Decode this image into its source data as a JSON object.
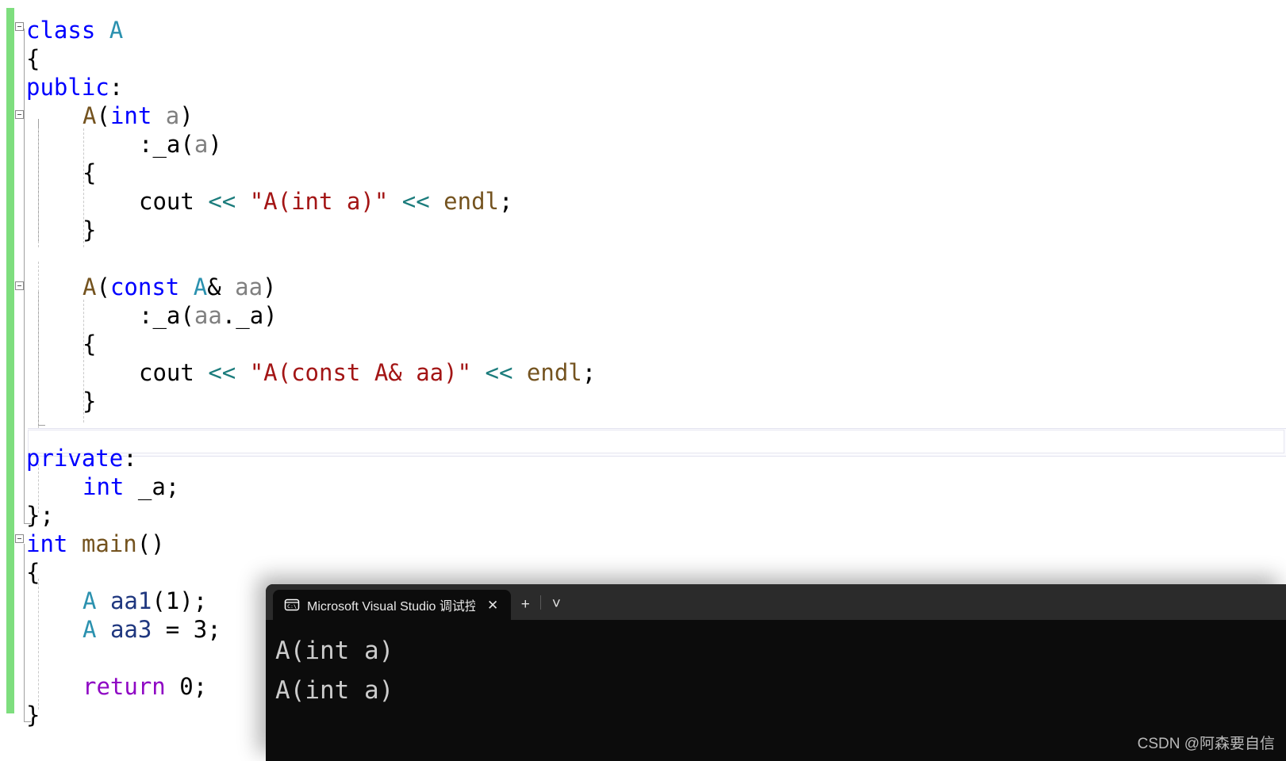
{
  "editor": {
    "name": "visual-studio-code-editor",
    "background": "#ffffff",
    "change_bar_color": "#7ede7e",
    "code_lines": [
      {
        "indent": 0,
        "tokens": [
          {
            "t": "class",
            "c": "kw"
          },
          {
            "t": " ",
            "c": "plain"
          },
          {
            "t": "A",
            "c": "type"
          }
        ]
      },
      {
        "indent": 0,
        "tokens": [
          {
            "t": "{",
            "c": "plain"
          }
        ]
      },
      {
        "indent": 0,
        "tokens": [
          {
            "t": "public",
            "c": "kw"
          },
          {
            "t": ":",
            "c": "plain"
          }
        ]
      },
      {
        "indent": 1,
        "tokens": [
          {
            "t": "A",
            "c": "fn"
          },
          {
            "t": "(",
            "c": "plain"
          },
          {
            "t": "int",
            "c": "kw"
          },
          {
            "t": " ",
            "c": "plain"
          },
          {
            "t": "a",
            "c": "param"
          },
          {
            "t": ")",
            "c": "plain"
          }
        ]
      },
      {
        "indent": 2,
        "tokens": [
          {
            "t": ":",
            "c": "plain"
          },
          {
            "t": "_a",
            "c": "member"
          },
          {
            "t": "(",
            "c": "plain"
          },
          {
            "t": "a",
            "c": "param"
          },
          {
            "t": ")",
            "c": "plain"
          }
        ]
      },
      {
        "indent": 1,
        "tokens": [
          {
            "t": "{",
            "c": "plain"
          }
        ]
      },
      {
        "indent": 2,
        "tokens": [
          {
            "t": "cout",
            "c": "plain"
          },
          {
            "t": " ",
            "c": "plain"
          },
          {
            "t": "<<",
            "c": "op"
          },
          {
            "t": " ",
            "c": "plain"
          },
          {
            "t": "\"A(int a)\"",
            "c": "str"
          },
          {
            "t": " ",
            "c": "plain"
          },
          {
            "t": "<<",
            "c": "op"
          },
          {
            "t": " ",
            "c": "plain"
          },
          {
            "t": "endl",
            "c": "fn"
          },
          {
            "t": ";",
            "c": "plain"
          }
        ]
      },
      {
        "indent": 1,
        "tokens": [
          {
            "t": "}",
            "c": "plain"
          }
        ]
      },
      {
        "indent": 0,
        "tokens": []
      },
      {
        "indent": 1,
        "tokens": [
          {
            "t": "A",
            "c": "fn"
          },
          {
            "t": "(",
            "c": "plain"
          },
          {
            "t": "const",
            "c": "kw"
          },
          {
            "t": " ",
            "c": "plain"
          },
          {
            "t": "A",
            "c": "type"
          },
          {
            "t": "&",
            "c": "plain"
          },
          {
            "t": " ",
            "c": "plain"
          },
          {
            "t": "aa",
            "c": "param"
          },
          {
            "t": ")",
            "c": "plain"
          }
        ]
      },
      {
        "indent": 2,
        "tokens": [
          {
            "t": ":",
            "c": "plain"
          },
          {
            "t": "_a",
            "c": "member"
          },
          {
            "t": "(",
            "c": "plain"
          },
          {
            "t": "aa",
            "c": "param"
          },
          {
            "t": ".",
            "c": "plain"
          },
          {
            "t": "_a",
            "c": "member"
          },
          {
            "t": ")",
            "c": "plain"
          }
        ]
      },
      {
        "indent": 1,
        "tokens": [
          {
            "t": "{",
            "c": "plain"
          }
        ]
      },
      {
        "indent": 2,
        "tokens": [
          {
            "t": "cout",
            "c": "plain"
          },
          {
            "t": " ",
            "c": "plain"
          },
          {
            "t": "<<",
            "c": "op"
          },
          {
            "t": " ",
            "c": "plain"
          },
          {
            "t": "\"A(const A& aa)\"",
            "c": "str"
          },
          {
            "t": " ",
            "c": "plain"
          },
          {
            "t": "<<",
            "c": "op"
          },
          {
            "t": " ",
            "c": "plain"
          },
          {
            "t": "endl",
            "c": "fn"
          },
          {
            "t": ";",
            "c": "plain"
          }
        ]
      },
      {
        "indent": 1,
        "tokens": [
          {
            "t": "}",
            "c": "plain"
          }
        ]
      },
      {
        "indent": 0,
        "tokens": []
      },
      {
        "indent": 0,
        "tokens": [
          {
            "t": "private",
            "c": "kw"
          },
          {
            "t": ":",
            "c": "plain"
          }
        ]
      },
      {
        "indent": 1,
        "tokens": [
          {
            "t": "int",
            "c": "kw"
          },
          {
            "t": " ",
            "c": "plain"
          },
          {
            "t": "_a",
            "c": "member"
          },
          {
            "t": ";",
            "c": "plain"
          }
        ]
      },
      {
        "indent": 0,
        "tokens": [
          {
            "t": "};",
            "c": "plain"
          }
        ]
      },
      {
        "indent": 0,
        "tokens": [
          {
            "t": "int",
            "c": "kw"
          },
          {
            "t": " ",
            "c": "plain"
          },
          {
            "t": "main",
            "c": "fn"
          },
          {
            "t": "()",
            "c": "plain"
          }
        ]
      },
      {
        "indent": 0,
        "tokens": [
          {
            "t": "{",
            "c": "plain"
          }
        ]
      },
      {
        "indent": 1,
        "tokens": [
          {
            "t": "A",
            "c": "type"
          },
          {
            "t": " ",
            "c": "plain"
          },
          {
            "t": "aa1",
            "c": "local"
          },
          {
            "t": "(",
            "c": "plain"
          },
          {
            "t": "1",
            "c": "plain"
          },
          {
            "t": ");",
            "c": "plain"
          }
        ]
      },
      {
        "indent": 1,
        "tokens": [
          {
            "t": "A",
            "c": "type"
          },
          {
            "t": " ",
            "c": "plain"
          },
          {
            "t": "aa3",
            "c": "local"
          },
          {
            "t": " = ",
            "c": "plain"
          },
          {
            "t": "3",
            "c": "plain"
          },
          {
            "t": ";",
            "c": "plain"
          }
        ]
      },
      {
        "indent": 0,
        "tokens": []
      },
      {
        "indent": 1,
        "tokens": [
          {
            "t": "return",
            "c": "ctrl"
          },
          {
            "t": " ",
            "c": "plain"
          },
          {
            "t": "0",
            "c": "plain"
          },
          {
            "t": ";",
            "c": "plain"
          }
        ]
      },
      {
        "indent": 0,
        "tokens": [
          {
            "t": "}",
            "c": "plain"
          }
        ]
      }
    ],
    "syntax_colors": {
      "keyword": "#0000ff",
      "control_keyword": "#8f08c4",
      "user_type": "#2b91af",
      "function": "#74531f",
      "string": "#a31515",
      "operator": "#1b7c7c",
      "parameter": "#808080",
      "local_variable": "#1f377f",
      "plain": "#000000"
    }
  },
  "terminal": {
    "name": "windows-terminal",
    "background": "#0c0c0c",
    "titlebar_background": "#2b2b2b",
    "tab": {
      "icon": "console-cmd-icon",
      "title": "Microsoft Visual Studio 调试控",
      "close_label": "✕"
    },
    "new_tab_label": "+",
    "dropdown_label": "˅",
    "output_lines": [
      "A(int a)",
      "A(int a)"
    ]
  },
  "watermark": {
    "text": "CSDN @阿森要自信"
  }
}
